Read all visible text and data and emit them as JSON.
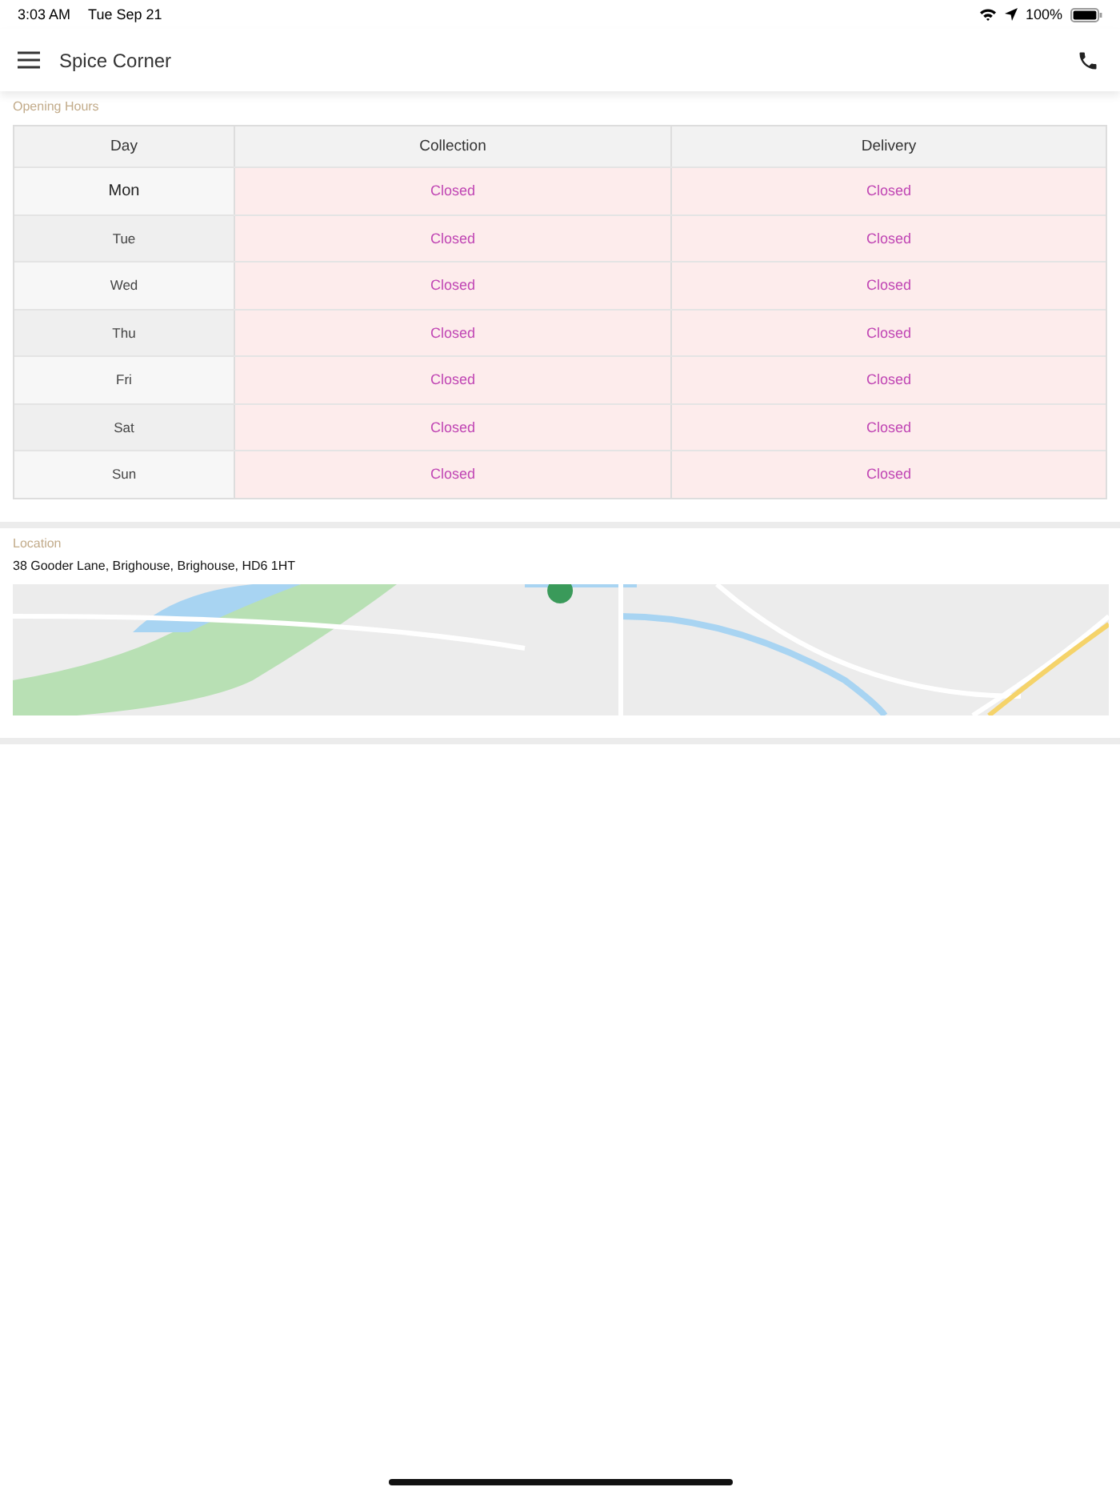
{
  "status_bar": {
    "time": "3:03 AM",
    "date": "Tue Sep 21",
    "battery": "100%"
  },
  "header": {
    "title": "Spice Corner"
  },
  "opening_hours": {
    "heading": "Opening Hours",
    "columns": [
      "Day",
      "Collection",
      "Delivery"
    ],
    "rows": [
      {
        "day": "Mon",
        "collection": "Closed",
        "delivery": "Closed",
        "highlighted": true
      },
      {
        "day": "Tue",
        "collection": "Closed",
        "delivery": "Closed",
        "highlighted": false
      },
      {
        "day": "Wed",
        "collection": "Closed",
        "delivery": "Closed",
        "highlighted": false
      },
      {
        "day": "Thu",
        "collection": "Closed",
        "delivery": "Closed",
        "highlighted": false
      },
      {
        "day": "Fri",
        "collection": "Closed",
        "delivery": "Closed",
        "highlighted": false
      },
      {
        "day": "Sat",
        "collection": "Closed",
        "delivery": "Closed",
        "highlighted": false
      },
      {
        "day": "Sun",
        "collection": "Closed",
        "delivery": "Closed",
        "highlighted": false
      }
    ]
  },
  "location": {
    "heading": "Location",
    "address": "38 Gooder Lane, Brighouse, Brighouse, HD6 1HT"
  }
}
